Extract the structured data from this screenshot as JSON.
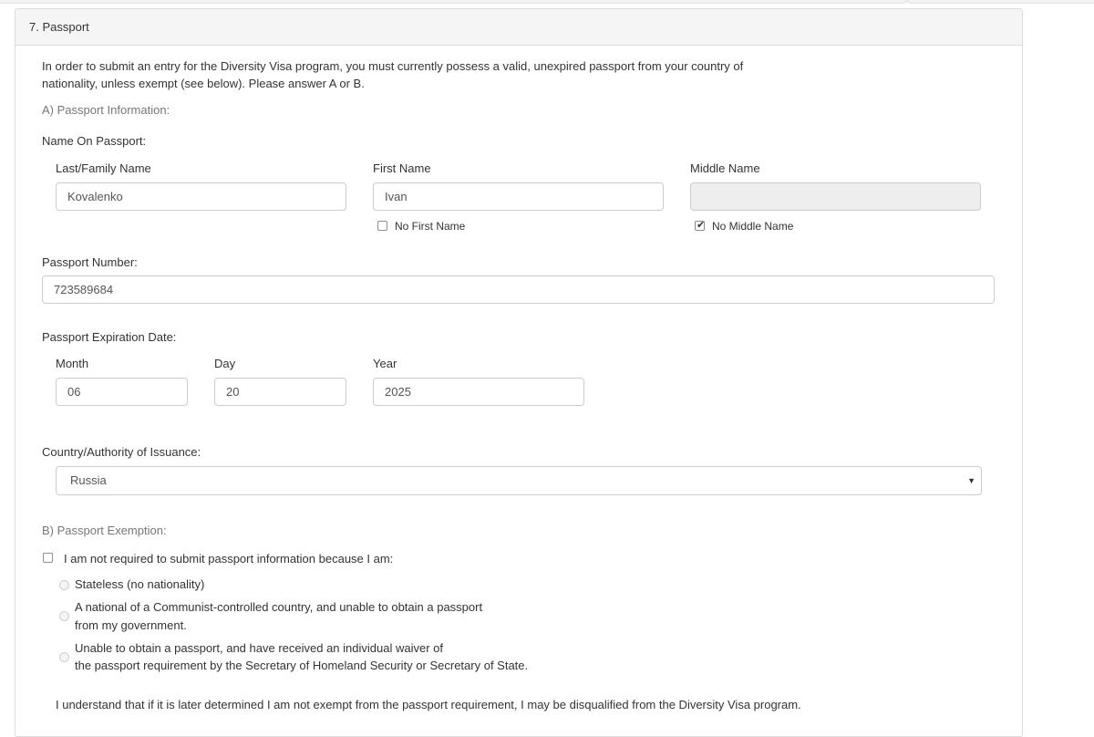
{
  "section_title": "7. Passport",
  "intro_line1": "In order to submit an entry for the Diversity Visa program, you must currently possess a valid, unexpired passport from your country of",
  "intro_line2": "nationality, unless exempt (see below). Please answer A or B.",
  "section_a_label": "A) Passport Information:",
  "name_on_passport_label": "Name On Passport:",
  "last_name": {
    "label": "Last/Family Name",
    "value": "Kovalenko"
  },
  "first_name": {
    "label": "First Name",
    "value": "Ivan",
    "no_label": "No First Name",
    "no_checked": false
  },
  "middle_name": {
    "label": "Middle Name",
    "value": "",
    "no_label": "No Middle Name",
    "no_checked": true
  },
  "passport_number": {
    "label": "Passport Number:",
    "value": "723589684"
  },
  "expiration": {
    "label": "Passport Expiration Date:",
    "month_label": "Month",
    "month": "06",
    "day_label": "Day",
    "day": "20",
    "year_label": "Year",
    "year": "2025"
  },
  "country": {
    "label": "Country/Authority of Issuance:",
    "value": "Russia"
  },
  "section_b_label": "B) Passport Exemption:",
  "exempt_checkbox_label": "I am not required to submit passport information because I am:",
  "options": [
    {
      "line1": "Stateless (no nationality)",
      "line2": ""
    },
    {
      "line1": "A national of a Communist-controlled country, and unable to obtain a passport",
      "line2": "from my government."
    },
    {
      "line1": "Unable to obtain a passport, and have received an individual waiver of",
      "line2": "the passport requirement by the Secretary of Homeland Security or Secretary of State."
    }
  ],
  "disclaimer": "I understand that if it is later determined I am not exempt from the passport requirement, I may be disqualified from the Diversity Visa program.",
  "icons": {
    "select_caret": "caret-down-icon",
    "checkmark": "checkmark-icon"
  }
}
